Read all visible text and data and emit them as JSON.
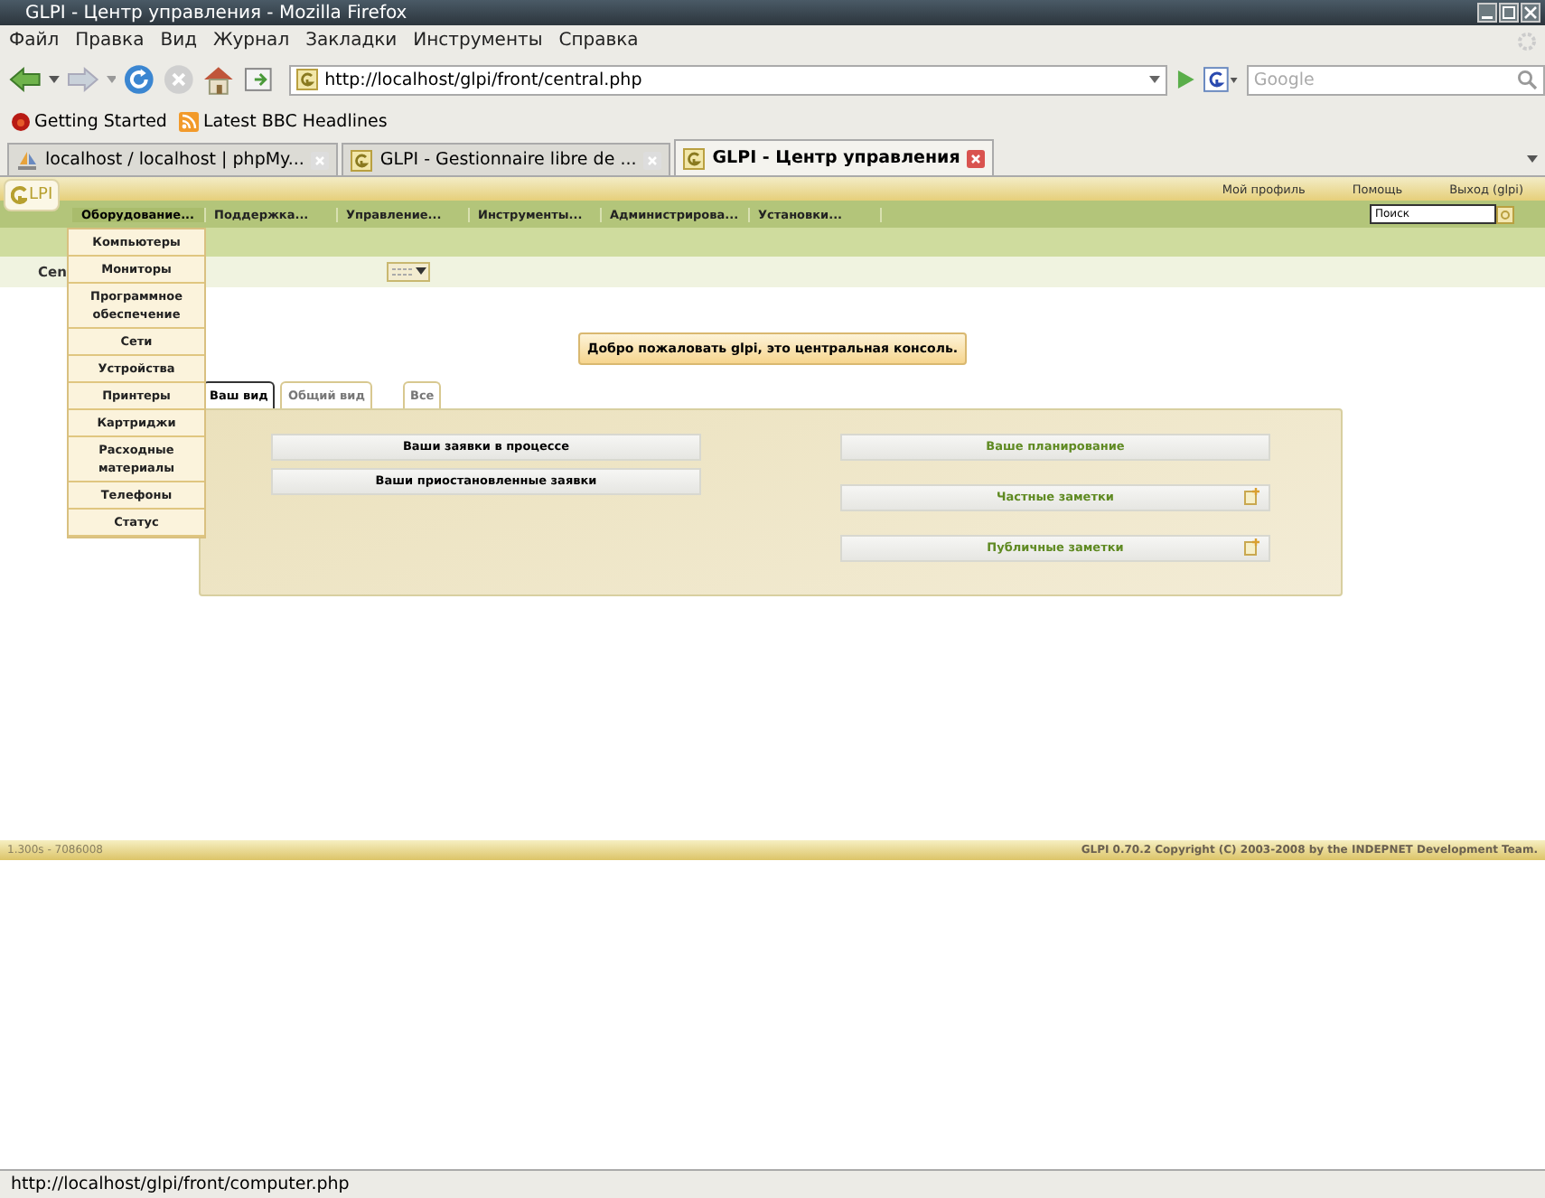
{
  "window": {
    "title": "GLPI - Центр управления - Mozilla Firefox"
  },
  "menubar": [
    "Файл",
    "Правка",
    "Вид",
    "Журнал",
    "Закладки",
    "Инструменты",
    "Справка"
  ],
  "address": {
    "value": "http://localhost/glpi/front/central.php"
  },
  "search": {
    "placeholder": "Google"
  },
  "bookmarks": [
    {
      "label": "Getting Started",
      "kind": "flame"
    },
    {
      "label": "Latest BBC Headlines",
      "kind": "feed"
    }
  ],
  "tabs": [
    {
      "label": "localhost / localhost | phpMy...",
      "selected": false,
      "kind": "pma"
    },
    {
      "label": "GLPI - Gestionnaire libre de ...",
      "selected": false,
      "kind": "glpi"
    },
    {
      "label": "GLPI - Центр управления",
      "selected": true,
      "kind": "glpi"
    }
  ],
  "page": {
    "logo": "LPI",
    "top_links": [
      "Мой профиль",
      "Помощь",
      "Выход (glpi)"
    ],
    "main_menu": [
      {
        "label": "Оборудование...",
        "expanded": true
      },
      {
        "label": "Поддержка...",
        "expanded": false
      },
      {
        "label": "Управление...",
        "expanded": false
      },
      {
        "label": "Инструменты...",
        "expanded": false
      },
      {
        "label": "Администрирова...",
        "expanded": false
      },
      {
        "label": "Установки...",
        "expanded": false
      }
    ],
    "search_field": {
      "value": "Поиск"
    },
    "breadcrumb": "Cen",
    "dropdown": [
      "Компьютеры",
      "Мониторы",
      "Программное обеспечение",
      "Сети",
      "Устройства",
      "Принтеры",
      "Картриджи",
      "Расходные материалы",
      "Телефоны",
      "Статус"
    ],
    "welcome": "Добро пожаловать glpi, это центральная консоль.",
    "view_tabs": [
      {
        "label": "Ваш вид",
        "selected": true
      },
      {
        "label": "Общий вид",
        "selected": false
      },
      {
        "label": "Все",
        "selected": false
      }
    ],
    "left_sections": [
      "Ваши заявки в процессе",
      "Ваши приостановленные заявки"
    ],
    "right_sections": [
      {
        "label": "Ваше планирование",
        "addable": false
      },
      {
        "label": "Частные заметки",
        "addable": true
      },
      {
        "label": "Публичные заметки",
        "addable": true
      }
    ],
    "footer_left": "1.300s - 7086008",
    "footer_right": "GLPI 0.70.2 Copyright (C) 2003-2008 by the INDEPNET Development Team."
  },
  "status_bar": "http://localhost/glpi/front/computer.php"
}
